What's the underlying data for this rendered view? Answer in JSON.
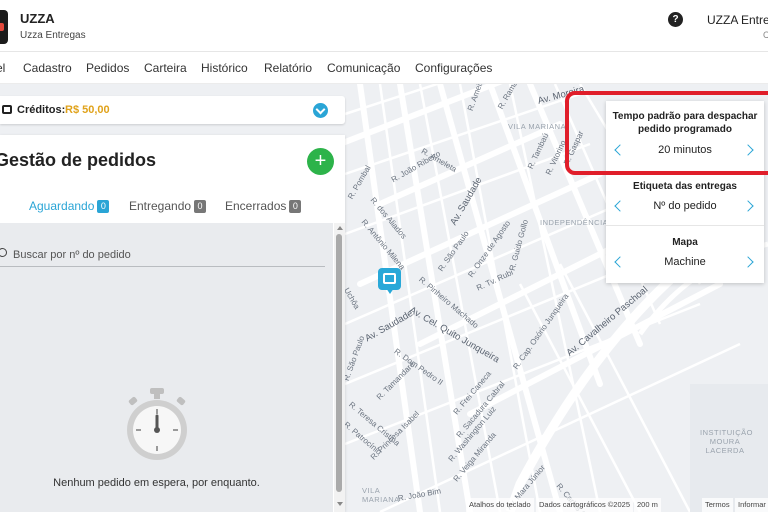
{
  "app": {
    "name": "UZZA",
    "subtitle": "Uzza Entregas",
    "help_icon": "help-circle-icon",
    "company_name": "UZZA Entregas",
    "company_sub": "C"
  },
  "nav": {
    "items": [
      "el",
      "Cadastro",
      "Pedidos",
      "Carteira",
      "Histórico",
      "Relatório",
      "Comunicação",
      "Configurações"
    ]
  },
  "credits": {
    "label": "Créditos:",
    "value": "R$ 50,00",
    "icon": "wallet-icon",
    "value_color": "#e0a21a"
  },
  "orders": {
    "title": "Gestão de pedidos",
    "add_label": "+",
    "tabs": [
      {
        "label": "Aguardando",
        "count": "0",
        "active": true
      },
      {
        "label": "Entregando",
        "count": "0",
        "active": false
      },
      {
        "label": "Encerrados",
        "count": "0",
        "active": false
      }
    ],
    "search_placeholder": "Buscar por nº do pedido",
    "empty_message": "Nenhum pedido em espera, por enquanto."
  },
  "settings": {
    "items": [
      {
        "title_line1": "Tempo padrão para despachar",
        "title_line2": "pedido programado",
        "value": "20 minutos"
      },
      {
        "title_line1": "Etiqueta das entregas",
        "title_line2": "",
        "value": "Nº do pedido"
      },
      {
        "title_line1": "Mapa",
        "title_line2": "",
        "value": "Machine"
      }
    ]
  },
  "map": {
    "streets": [
      "R. Ameixeiras",
      "R. Ramalho",
      "Av. Moreira",
      "R. Tambaú",
      "R. Vitorino",
      "R. Gaspar",
      "R. Ameleta",
      "R. João Ribeiro",
      "R. dos Aliados",
      "R. Antônio Milena",
      "Av. Saudade",
      "R. São Paulo",
      "R. Onze de Agosto",
      "R. Guido Gollo",
      "R. Tv. Rubi",
      "R. Pinheiro Machado",
      "Av. Cel. Quito Junqueira",
      "R. Dom Pedro II",
      "R. Tamandaré",
      "R. Teresa Cristina",
      "R. Patrocínio",
      "R. Princesa Isabel",
      "R. Frei Caneca",
      "R. Sacadura Cabral",
      "R. Washington Luiz",
      "R. Veiga Miranda",
      "Av. Cavalheiro Paschoal",
      "R. Cap. Osório Junqueira",
      "Av. Saudade",
      "R. João Bim",
      "Av. Mara Júnior",
      "R. Carlos Alves",
      "R. São Paulo",
      "Uchôa",
      "R. Pombal"
    ],
    "areas": [
      "VILA MARIANA",
      "INDEPENDÊNCIA",
      "INSTITUIÇÃO MOURA LACERDA",
      "VILA MARIANA"
    ],
    "attribution": [
      "Atalhos do teclado",
      "Dados cartográficos ©2025",
      "200 m",
      "Termos",
      "Informar"
    ]
  },
  "colors": {
    "accent": "#2aa5d6",
    "add_button": "#2db34a",
    "highlight": "#e01e2a",
    "pin": "#29a8d8"
  }
}
